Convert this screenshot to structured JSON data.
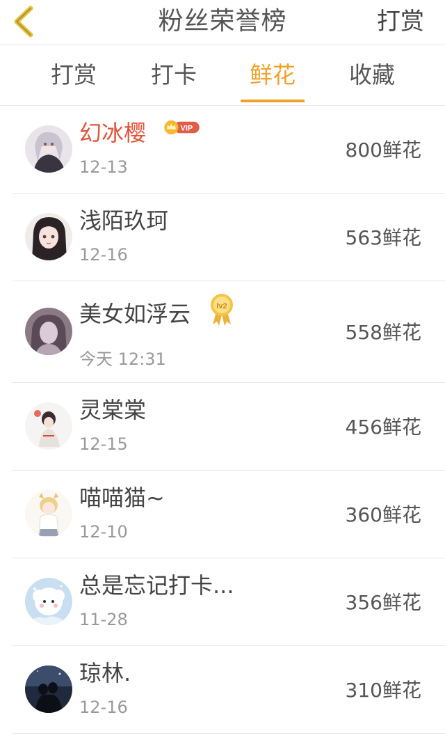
{
  "header": {
    "title": "粉丝荣誉榜",
    "action_label": "打赏"
  },
  "tabs": [
    {
      "label": "打赏",
      "active": false
    },
    {
      "label": "打卡",
      "active": false
    },
    {
      "label": "鲜花",
      "active": true
    },
    {
      "label": "收藏",
      "active": false
    }
  ],
  "colors": {
    "accent": "#f0a32b",
    "vip_name": "#e0543a"
  },
  "list": [
    {
      "name": "幻冰樱",
      "date": "12-13",
      "amount": "800鲜花",
      "badge": "crown-vip-icon",
      "badge_text": "VIP"
    },
    {
      "name": "浅陌玖珂",
      "date": "12-16",
      "amount": "563鲜花"
    },
    {
      "name": "美女如浮云",
      "date": "今天 12:31",
      "amount": "558鲜花",
      "badge": "level-medal-icon",
      "badge_text": "lv2"
    },
    {
      "name": "灵棠棠",
      "date": "12-15",
      "amount": "456鲜花"
    },
    {
      "name": "喵喵猫~",
      "date": "12-10",
      "amount": "360鲜花"
    },
    {
      "name": "总是忘记打卡...",
      "date": "11-28",
      "amount": "356鲜花"
    },
    {
      "name": "琼林.",
      "date": "12-16",
      "amount": "310鲜花"
    }
  ]
}
